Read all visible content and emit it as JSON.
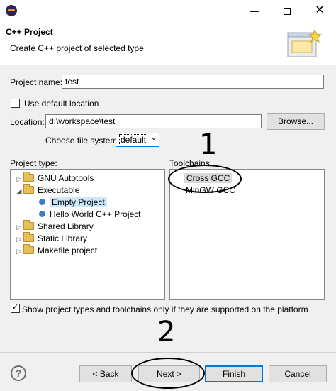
{
  "titlebar": {
    "min": "—",
    "max": "",
    "close": "✕"
  },
  "banner": {
    "title": "C++ Project",
    "subtitle": "Create C++ project of selected type"
  },
  "project_name": {
    "label": "Project name:",
    "value": "test"
  },
  "default_location": {
    "label": "Use default location",
    "checked": false
  },
  "location": {
    "label": "Location:",
    "value": "d:\\workspace\\test",
    "browse": "Browse..."
  },
  "file_system": {
    "label": "Choose file system:",
    "value": "default"
  },
  "project_type": {
    "label": "Project type:",
    "items": [
      {
        "label": "GNU Autotools"
      },
      {
        "label": "Executable"
      },
      {
        "label": "Empty Project"
      },
      {
        "label": "Hello World C++ Project"
      },
      {
        "label": "Shared Library"
      },
      {
        "label": "Static Library"
      },
      {
        "label": "Makefile project"
      }
    ]
  },
  "toolchains": {
    "label": "Toolchains:",
    "items": [
      {
        "label": "Cross GCC"
      },
      {
        "label": "MinGW GCC"
      }
    ]
  },
  "show_supported": {
    "label": "Show project types and toolchains only if they are supported on the platform",
    "checked": true
  },
  "annotations": {
    "one": "1",
    "two": "2"
  },
  "footer": {
    "help": "?",
    "back": "< Back",
    "next": "Next >",
    "finish": "Finish",
    "cancel": "Cancel"
  }
}
